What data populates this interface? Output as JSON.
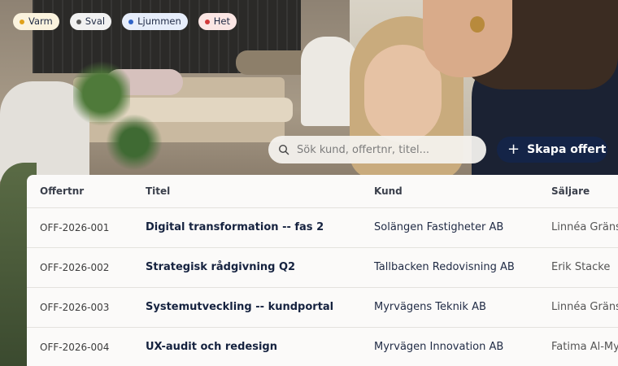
{
  "tags": [
    {
      "label": "Varm",
      "dot": "#e0a21b",
      "bg": "#fbf3de"
    },
    {
      "label": "Sval",
      "dot": "#5a5a5a",
      "bg": "#f1f1f1"
    },
    {
      "label": "Ljummen",
      "dot": "#2f63c7",
      "bg": "#e7eefb"
    },
    {
      "label": "Het",
      "dot": "#d23a3a",
      "bg": "#fbe6e4"
    }
  ],
  "search": {
    "placeholder": "Sök kund, offertnr, titel..."
  },
  "create_button": {
    "label": "Skapa offert",
    "icon": "plus-icon"
  },
  "table": {
    "columns": {
      "nr": "Offertnr",
      "titel": "Titel",
      "kund": "Kund",
      "saljare": "Säljare"
    },
    "rows": [
      {
        "nr": "OFF-2026-001",
        "titel": "Digital transformation -- fas 2",
        "kund": "Solängen Fastigheter AB",
        "saljare": "Linnéa Gräns"
      },
      {
        "nr": "OFF-2026-002",
        "titel": "Strategisk rådgivning Q2",
        "kund": "Tallbacken Redovisning AB",
        "saljare": "Erik Stacke"
      },
      {
        "nr": "OFF-2026-003",
        "titel": "Systemutveckling -- kundportal",
        "kund": "Myrvägens Teknik AB",
        "saljare": "Linnéa Gräns"
      },
      {
        "nr": "OFF-2026-004",
        "titel": "UX-audit och redesign",
        "kund": "Myrvägen Innovation AB",
        "saljare": "Fatima Al-My"
      }
    ]
  },
  "colors": {
    "accent": "#142447",
    "table_bg": "#fbfaf9"
  }
}
